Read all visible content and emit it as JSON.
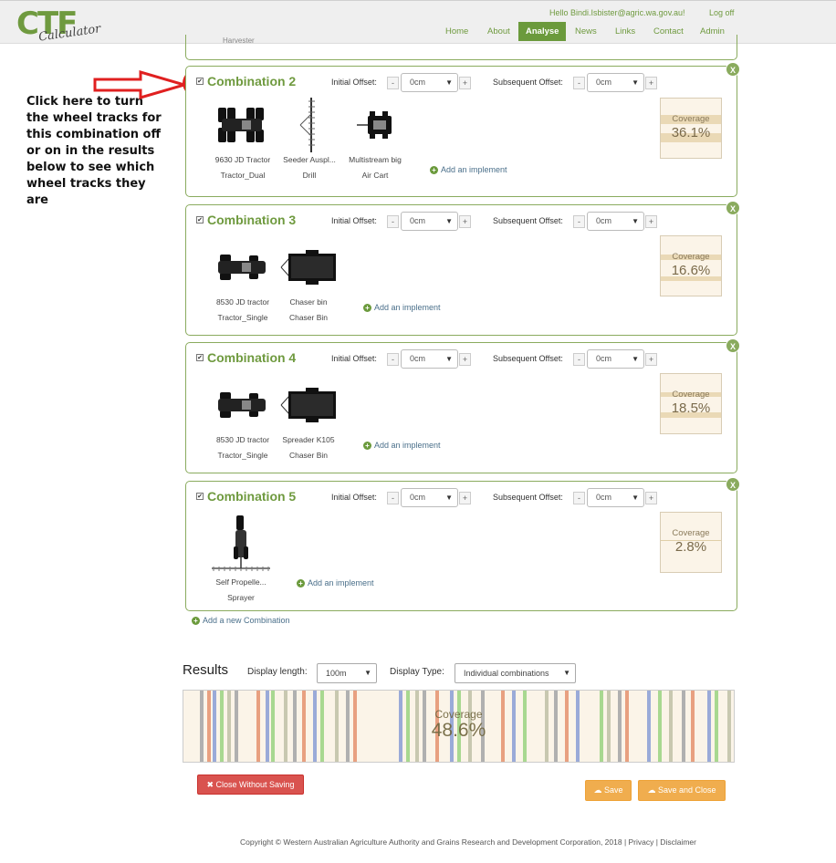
{
  "header": {
    "logo_text": "CTF",
    "logo_subtext": "Calculator",
    "greeting": "Hello Bindi.Isbister@agric.wa.gov.au!",
    "logoff": "Log off",
    "nav": [
      "Home",
      "About",
      "Analyse",
      "News",
      "Links",
      "Contact",
      "Admin"
    ],
    "active_nav": "Analyse"
  },
  "annotation": {
    "text": "Click here to turn the wheel tracks for this combination off or on in the results below to see which wheel tracks they are",
    "color": "#e02020"
  },
  "previous_panel_stub_text": "Harvester",
  "labels": {
    "initial_offset": "Initial Offset:",
    "subsequent_offset": "Subsequent Offset:",
    "add_implement": "Add an implement",
    "coverage": "Coverage",
    "remove": "X",
    "minus": "-",
    "plus": "+",
    "checkmark": "✔"
  },
  "combinations": [
    {
      "title": "Combination 2",
      "checked": true,
      "initial_offset": "0cm",
      "subsequent_offset": "0cm",
      "coverage": "36.1%",
      "implements": [
        {
          "name": "9630 JD Tractor",
          "type": "Tractor_Dual",
          "icon": "dual-tractor-icon"
        },
        {
          "name": "Seeder Auspl...",
          "type": "Drill",
          "icon": "seeder-icon"
        },
        {
          "name": "Multistream big",
          "type": "Air Cart",
          "icon": "air-cart-icon"
        }
      ]
    },
    {
      "title": "Combination 3",
      "checked": true,
      "initial_offset": "0cm",
      "subsequent_offset": "0cm",
      "coverage": "16.6%",
      "implements": [
        {
          "name": "8530 JD tractor",
          "type": "Tractor_Single",
          "icon": "tractor-icon"
        },
        {
          "name": "Chaser bin",
          "type": "Chaser Bin",
          "icon": "chaser-bin-icon"
        }
      ]
    },
    {
      "title": "Combination 4",
      "checked": true,
      "initial_offset": "0cm",
      "subsequent_offset": "0cm",
      "coverage": "18.5%",
      "implements": [
        {
          "name": "8530 JD tractor",
          "type": "Tractor_Single",
          "icon": "tractor-icon"
        },
        {
          "name": "Spreader K105",
          "type": "Chaser Bin",
          "icon": "chaser-bin-icon"
        }
      ]
    },
    {
      "title": "Combination 5",
      "checked": true,
      "initial_offset": "0cm",
      "subsequent_offset": "0cm",
      "coverage": "2.8%",
      "implements": [
        {
          "name": "Self Propelle...",
          "type": "Sprayer",
          "icon": "sprayer-icon"
        }
      ]
    }
  ],
  "add_combination": "Add a new Combination",
  "results": {
    "title": "Results",
    "display_length_label": "Display length:",
    "display_length_value": "100m",
    "display_type_label": "Display Type:",
    "display_type_value": "Individual combinations",
    "coverage_label": "Coverage",
    "coverage_value": "48.6%",
    "track_colors": [
      "#b0b0b0",
      "#e8a080",
      "#9aaad8",
      "#a8d890",
      "#c8c8b0"
    ]
  },
  "buttons": {
    "close_without_saving": "Close Without Saving",
    "save": "Save",
    "save_and_close": "Save and Close"
  },
  "footer": "Copyright © Western Australian Agriculture Authority and Grains Research and Development Corporation, 2018 | Privacy | Disclaimer"
}
